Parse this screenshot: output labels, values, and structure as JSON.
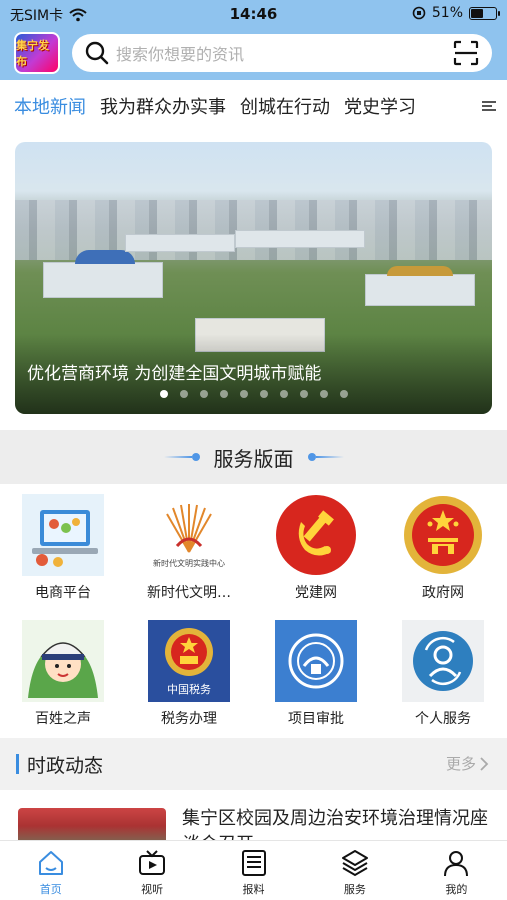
{
  "status_bar": {
    "carrier": "无SIM卡",
    "time": "14:46",
    "battery": "51%",
    "battery_level": 0.51
  },
  "app": {
    "logo_text": "集宁发布"
  },
  "search": {
    "placeholder": "搜索你想要的资讯"
  },
  "tabs": [
    {
      "label": "本地新闻",
      "active": true
    },
    {
      "label": "我为群众办实事",
      "active": false
    },
    {
      "label": "创城在行动",
      "active": false
    },
    {
      "label": "党史学习",
      "active": false
    }
  ],
  "banner": {
    "caption": "优化营商环境 为创建全国文明城市赋能",
    "slide_count": 10,
    "active_slide": 1
  },
  "service_section": {
    "title": "服务版面"
  },
  "services": [
    {
      "label": "电商平台",
      "icon": "ecommerce-icon"
    },
    {
      "label": "新时代文明…",
      "icon": "civilization-center-icon",
      "logo_text": "新时代文明实践中心"
    },
    {
      "label": "党建网",
      "icon": "party-emblem-icon"
    },
    {
      "label": "政府网",
      "icon": "national-emblem-icon"
    },
    {
      "label": "百姓之声",
      "icon": "police-mascot-icon"
    },
    {
      "label": "税务办理",
      "icon": "tax-emblem-icon",
      "logo_text": "中国税务"
    },
    {
      "label": "项目审批",
      "icon": "approval-icon"
    },
    {
      "label": "个人服务",
      "icon": "personal-service-icon"
    }
  ],
  "news_section": {
    "title": "时政动态",
    "more_label": "更多"
  },
  "news": [
    {
      "title": "集宁区校园及周边治安环境治理情况座谈会召开"
    }
  ],
  "bottom_nav": [
    {
      "label": "首页",
      "icon": "home-icon",
      "active": true
    },
    {
      "label": "视听",
      "icon": "video-icon",
      "active": false
    },
    {
      "label": "报料",
      "icon": "newspaper-icon",
      "active": false
    },
    {
      "label": "服务",
      "icon": "layers-icon",
      "active": false
    },
    {
      "label": "我的",
      "icon": "user-icon",
      "active": false
    }
  ],
  "colors": {
    "header_bg": "#8fc3ee",
    "accent": "#3a8de0",
    "section_bg": "#ededed"
  }
}
